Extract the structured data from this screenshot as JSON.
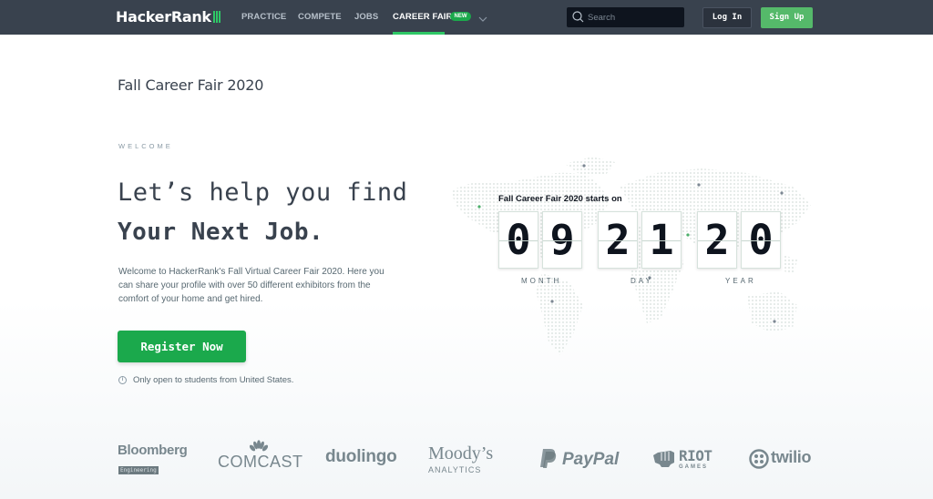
{
  "nav": {
    "brand": "HackerRank",
    "items": [
      {
        "label": "PRACTICE",
        "active": false
      },
      {
        "label": "COMPETE",
        "active": false
      },
      {
        "label": "JOBS",
        "active": false
      },
      {
        "label": "CAREER FAIR",
        "active": true
      }
    ],
    "new_badge": "NEW",
    "search_placeholder": "Search",
    "login_label": "Log In",
    "signup_label": "Sign Up"
  },
  "page": {
    "title": "Fall Career Fair 2020",
    "eyebrow": "WELCOME",
    "headline_light": "Let’s help you find",
    "headline_bold": "Your Next Job.",
    "intro": "Welcome to HackerRank's Fall Virtual Career Fair 2020. Here you can share your profile with over 50 different exhibitors from the comfort of your home and get hired.",
    "register_label": "Register Now",
    "eligibility_note": "Only open to students from United States."
  },
  "countdown": {
    "title": "Fall Career Fair 2020 starts on",
    "month": [
      "0",
      "9"
    ],
    "day": [
      "2",
      "1"
    ],
    "year": [
      "2",
      "0"
    ],
    "labels": {
      "month": "MONTH",
      "day": "DAY",
      "year": "YEAR"
    }
  },
  "exhibitors": {
    "bloomberg": "Bloomberg",
    "bloomberg_sub": "Engineering",
    "comcast": "COMCAST",
    "duolingo": "duolingo",
    "moodys": "Moody’s",
    "moodys_sub": "ANALYTICS",
    "paypal": "PayPal",
    "riot": "RIOT",
    "riot_sub": "GAMES",
    "twilio": "twilio"
  },
  "colors": {
    "nav_bg": "#39424e",
    "accent_green": "#1ba94c",
    "brand_green": "#2ec866",
    "text_dark": "#39424e",
    "logo_gray": "#78878e"
  }
}
